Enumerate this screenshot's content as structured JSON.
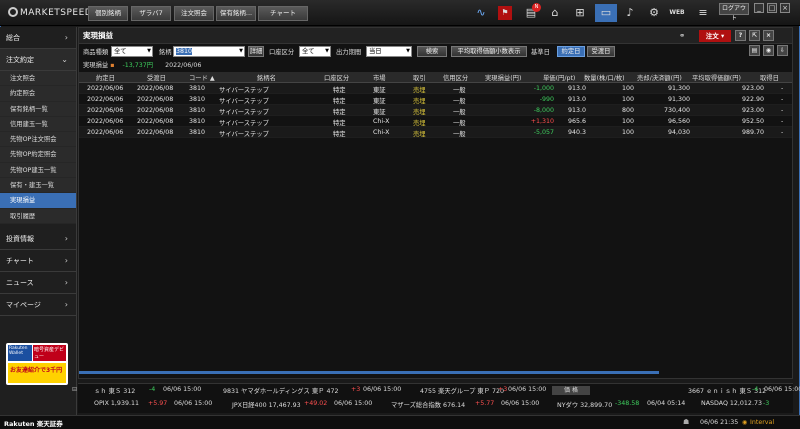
{
  "app": {
    "logo": "MARKETSPEEDⅡ"
  },
  "topnav": [
    {
      "label": "個別銘柄"
    },
    {
      "label": "ザラバ7"
    },
    {
      "label": "注文照会"
    },
    {
      "label": "保有銘柄..."
    },
    {
      "label": "チャート"
    }
  ],
  "topright": {
    "logout": "ログアウト",
    "web": "WEB"
  },
  "sidebar": {
    "top_items": [
      {
        "label": "総合"
      },
      {
        "label": "注文約定"
      }
    ],
    "sub_items": [
      {
        "label": "注文照会"
      },
      {
        "label": "約定照会"
      },
      {
        "label": "保有銘柄一覧"
      },
      {
        "label": "信用建玉一覧"
      },
      {
        "label": "先物OP注文照会"
      },
      {
        "label": "先物OP約定照会"
      },
      {
        "label": "先物OP建玉一覧"
      },
      {
        "label": "保有・建玉一覧"
      },
      {
        "label": "実現損益"
      },
      {
        "label": "取引履歴"
      }
    ],
    "bottom_items": [
      {
        "label": "投資情報"
      },
      {
        "label": "チャート"
      },
      {
        "label": "ニュース"
      },
      {
        "label": "マイページ"
      }
    ],
    "ad": {
      "line1": "Rakuten Wallet",
      "line2": "暗号資産デビュー",
      "line3": "お友達紹介で3千円"
    }
  },
  "panel": {
    "title": "実現損益",
    "order_button": "注文",
    "filters": {
      "product_label": "商品種類",
      "product_value": "全て",
      "symbol_label": "銘柄",
      "symbol_value": "3810",
      "detail_button": "詳細",
      "account_label": "口座区分",
      "account_value": "全て",
      "period_label": "出力期間",
      "period_value": "当日",
      "search_button": "検索",
      "avg_button": "平均取得価額小数表示",
      "base_label": "基準日",
      "base_on": "約定日",
      "base_off": "受渡日"
    },
    "summary": {
      "label": "実現損益",
      "value": "-13,737円",
      "date": "2022/06/06"
    },
    "columns": [
      "約定日",
      "受渡日",
      "コード",
      "銘柄名",
      "口座区分",
      "市場",
      "取引",
      "信用区分",
      "実現損益(円)",
      "単価(円/pt)",
      "数量(株/口/枚)",
      "売却/決済額(円)",
      "平均取得価額(円)",
      "取得日"
    ],
    "rows": [
      {
        "trade": "2022/06/06",
        "settle": "2022/06/08",
        "code": "3810",
        "name": "サイバーステップ",
        "account": "特定",
        "market": "東証",
        "type": "売埋",
        "credit": "一般",
        "pnl": "-1,000",
        "price": "913.0",
        "qty": "100",
        "amount": "91,300",
        "avg": "923.00",
        "acq": "-"
      },
      {
        "trade": "2022/06/06",
        "settle": "2022/06/08",
        "code": "3810",
        "name": "サイバーステップ",
        "account": "特定",
        "market": "東証",
        "type": "売埋",
        "credit": "一般",
        "pnl": "-990",
        "price": "913.0",
        "qty": "100",
        "amount": "91,300",
        "avg": "922.90",
        "acq": "-"
      },
      {
        "trade": "2022/06/06",
        "settle": "2022/06/08",
        "code": "3810",
        "name": "サイバーステップ",
        "account": "特定",
        "market": "東証",
        "type": "売埋",
        "credit": "一般",
        "pnl": "-8,000",
        "price": "913.0",
        "qty": "800",
        "amount": "730,400",
        "avg": "923.00",
        "acq": "-"
      },
      {
        "trade": "2022/06/06",
        "settle": "2022/06/08",
        "code": "3810",
        "name": "サイバーステップ",
        "account": "特定",
        "market": "Chi-X",
        "type": "売埋",
        "credit": "一般",
        "pnl": "+1,310",
        "price": "965.6",
        "qty": "100",
        "amount": "96,560",
        "avg": "952.50",
        "acq": "-"
      },
      {
        "trade": "2022/06/06",
        "settle": "2022/06/08",
        "code": "3810",
        "name": "サイバーステップ",
        "account": "特定",
        "market": "Chi-X",
        "type": "売埋",
        "credit": "一般",
        "pnl": "-5,057",
        "price": "940.3",
        "qty": "100",
        "amount": "94,030",
        "avg": "989.70",
        "acq": "-"
      }
    ]
  },
  "ticker": {
    "line1": [
      {
        "text": "ｓｈ 東Ｓ 312",
        "cls": ""
      },
      {
        "text": "-4",
        "cls": "grn"
      },
      {
        "text": "06/06 15:00",
        "cls": ""
      },
      {
        "text": "9831 ヤマダホールディングス 東Ｐ 472",
        "cls": ""
      },
      {
        "text": "+3",
        "cls": "red"
      },
      {
        "text": "06/06 15:00",
        "cls": ""
      },
      {
        "text": "4755 楽天グループ 東Ｐ 720",
        "cls": ""
      },
      {
        "text": "+3",
        "cls": "red"
      },
      {
        "text": "06/06 15:00",
        "cls": ""
      },
      {
        "text": "3667 ｅｎｉｓｈ 東Ｓ 312",
        "cls": ""
      },
      {
        "text": "-4",
        "cls": "grn"
      },
      {
        "text": "06/06 15:00",
        "cls": ""
      },
      {
        "text": "98",
        "cls": ""
      }
    ],
    "badge": "価 格",
    "line2": [
      {
        "text": "OPIX 1,939.11",
        "cls": ""
      },
      {
        "text": "+5.97",
        "cls": "red"
      },
      {
        "text": "06/06 15:00",
        "cls": ""
      },
      {
        "text": "JPX日経400 17,467.93",
        "cls": ""
      },
      {
        "text": "+49.02",
        "cls": "red"
      },
      {
        "text": "06/06 15:00",
        "cls": ""
      },
      {
        "text": "マザーズ総合指数 676.14",
        "cls": ""
      },
      {
        "text": "+5.77",
        "cls": "red"
      },
      {
        "text": "06/06 15:00",
        "cls": ""
      },
      {
        "text": "NYダウ 32,899.70",
        "cls": ""
      },
      {
        "text": "-348.58",
        "cls": "grn"
      },
      {
        "text": "06/04 05:14",
        "cls": ""
      },
      {
        "text": "NASDAQ 12,012.73",
        "cls": ""
      },
      {
        "text": "-3",
        "cls": "grn"
      }
    ]
  },
  "status": {
    "brand": "Rakuten 楽天証券",
    "time": "06/06 21:35",
    "interval": "Interval"
  },
  "colors": {
    "accent": "#3a6fb5",
    "loss": "#3ecf5e",
    "gain": "#ff4d4d",
    "sell": "#d7c23a",
    "order": "#b01010"
  }
}
